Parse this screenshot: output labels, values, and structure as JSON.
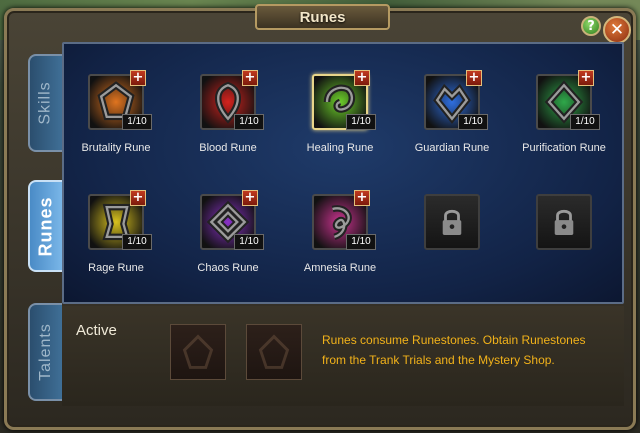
{
  "window": {
    "title": "Runes",
    "help_symbol": "?",
    "close_symbol": "✕"
  },
  "tabs": [
    {
      "label": "Skills",
      "active": false
    },
    {
      "label": "Runes",
      "active": true
    },
    {
      "label": "Talents",
      "active": false
    }
  ],
  "runes": [
    {
      "name": "Brutality Rune",
      "level": "1/10",
      "color": "#e0741f",
      "icon": "brutality-rune-icon",
      "upgrade": "+"
    },
    {
      "name": "Blood Rune",
      "level": "1/10",
      "color": "#d4231e",
      "icon": "blood-rune-icon",
      "upgrade": "+"
    },
    {
      "name": "Healing Rune",
      "level": "1/10",
      "color": "#6ccd2a",
      "icon": "healing-rune-icon",
      "upgrade": "+",
      "selected": true
    },
    {
      "name": "Guardian Rune",
      "level": "1/10",
      "color": "#2f6fe0",
      "icon": "guardian-rune-icon",
      "upgrade": "+"
    },
    {
      "name": "Purification Rune",
      "level": "1/10",
      "color": "#2fa84a",
      "icon": "purification-rune-icon",
      "upgrade": "+"
    },
    {
      "name": "Rage Rune",
      "level": "1/10",
      "color": "#d9c21e",
      "icon": "rage-rune-icon",
      "upgrade": "+"
    },
    {
      "name": "Chaos Rune",
      "level": "1/10",
      "color": "#8a32c9",
      "icon": "chaos-rune-icon",
      "upgrade": "+"
    },
    {
      "name": "Amnesia Rune",
      "level": "1/10",
      "color": "#c9338f",
      "icon": "amnesia-rune-icon",
      "upgrade": "+"
    }
  ],
  "locked_slots": [
    "lock-icon",
    "lock-icon"
  ],
  "active": {
    "label": "Active",
    "hint": "Runes consume Runestones. Obtain Runestones from the Trank Trials and the Mystery Shop."
  }
}
